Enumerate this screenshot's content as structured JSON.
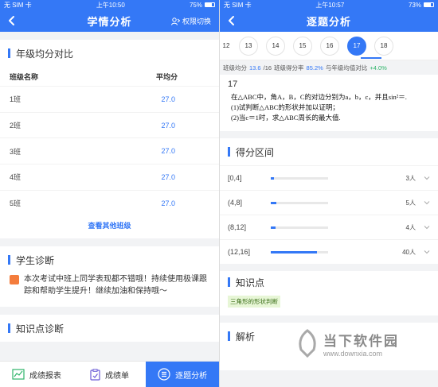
{
  "left": {
    "status": {
      "carrier": "无 SIM 卡",
      "time": "上午10:50",
      "battery": "75%",
      "battery_level": 0.75
    },
    "nav": {
      "title": "学情分析",
      "switch_label": "权限切换"
    },
    "grade_section": {
      "title": "年级均分对比",
      "header_class": "班级名称",
      "header_avg": "平均分",
      "rows": [
        {
          "name": "1班",
          "avg": "27.0"
        },
        {
          "name": "2班",
          "avg": "27.0"
        },
        {
          "name": "3班",
          "avg": "27.0"
        },
        {
          "name": "4班",
          "avg": "27.0"
        },
        {
          "name": "5班",
          "avg": "27.0"
        }
      ],
      "more_label": "查看其他班级"
    },
    "diagnosis": {
      "title": "学生诊断",
      "text": "本次考试中班上同学表现都不错哦！持续使用极课跟踪和帮助学生提升！继续加油和保持哦～"
    },
    "knowledge": {
      "title": "知识点诊断"
    },
    "tabs": [
      {
        "label": "成绩报表",
        "icon": "chart-icon",
        "color": "#2fb56a"
      },
      {
        "label": "成绩单",
        "icon": "clipboard-icon",
        "color": "#6b5bd6"
      },
      {
        "label": "逐题分析",
        "icon": "list-icon",
        "color": "#ffffff",
        "active": true
      }
    ]
  },
  "right": {
    "status": {
      "carrier": "无 SIM 卡",
      "time": "上午10:57",
      "battery": "73%",
      "battery_level": 0.73
    },
    "nav": {
      "title": "逐题分析"
    },
    "questions": [
      "12",
      "13",
      "14",
      "15",
      "16",
      "17",
      "18"
    ],
    "active_question": "17",
    "stats": {
      "avg_label": "班级均分",
      "avg_value": "13.6",
      "avg_total": "/16",
      "rate_label": "班级得分率",
      "rate_value": "85.2%",
      "compare_label": "与年级均值对比",
      "compare_value": "+4.0%"
    },
    "question": {
      "number": "17",
      "line1": "在△ABC中，角A，B，C的对边分别为a，b，c，并且sin²＝.",
      "line2": "(1)试判断△ABC的形状并加以证明；",
      "line3": "(2)当c＝1时，求△ABC周长的最大值."
    },
    "score_range": {
      "title": "得分区间",
      "rows": [
        {
          "range": "[0,4]",
          "count": "3人",
          "fraction": 0.06
        },
        {
          "range": "(4,8]",
          "count": "5人",
          "fraction": 0.1
        },
        {
          "range": "(8,12]",
          "count": "4人",
          "fraction": 0.08
        },
        {
          "range": "(12,16]",
          "count": "40人",
          "fraction": 0.8
        }
      ]
    },
    "knowledge": {
      "title": "知识点",
      "tag": "三角形的形状判断"
    },
    "analysis": {
      "title": "解析"
    }
  },
  "watermark": {
    "brand": "当下软件园",
    "url": "www.downxia.com"
  },
  "colors": {
    "accent": "#3478f6",
    "positive": "#2fb56a",
    "diagnosis_icon": "#f47c3c"
  }
}
